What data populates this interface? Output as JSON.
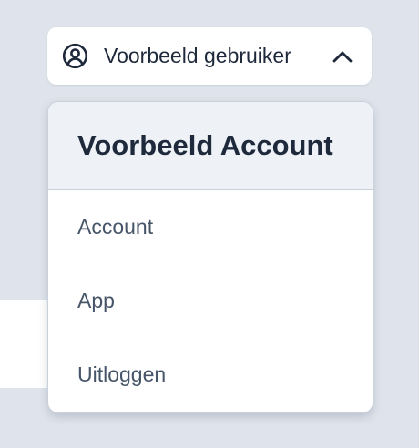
{
  "user_menu": {
    "label": "Voorbeeld gebruiker",
    "icon": "user-circle-icon",
    "toggle_icon": "chevron-up-icon",
    "expanded": true
  },
  "dropdown": {
    "title": "Voorbeeld Account",
    "items": [
      {
        "label": "Account"
      },
      {
        "label": "App"
      },
      {
        "label": "Uitloggen"
      }
    ]
  },
  "colors": {
    "background": "#dfe4ec",
    "surface": "#ffffff",
    "header_bg": "#eef2f7",
    "text_primary": "#1e293b",
    "text_secondary": "#475569",
    "border": "#c9d1dc"
  }
}
